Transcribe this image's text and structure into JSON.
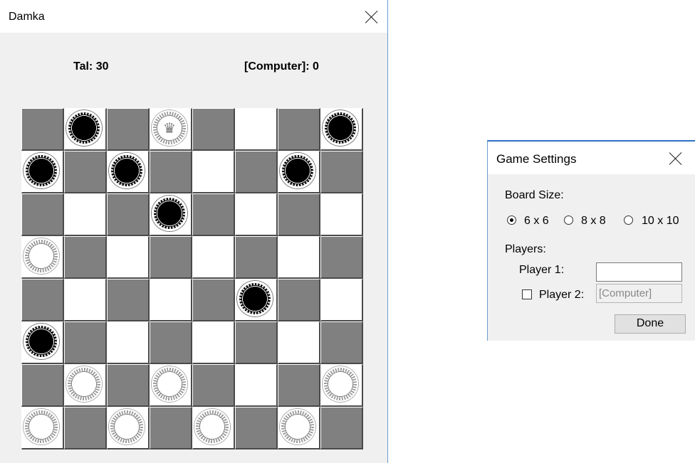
{
  "damka": {
    "title": "Damka",
    "score_player1": "Tal: 30",
    "score_player2": "[Computer]: 0",
    "board": [
      [
        "",
        "B",
        "",
        "WK",
        "",
        "",
        "",
        "B"
      ],
      [
        "B",
        "",
        "B",
        "",
        "",
        "",
        "B",
        ""
      ],
      [
        "",
        "",
        "",
        "B",
        "",
        "",
        "",
        ""
      ],
      [
        "W",
        "",
        "",
        "",
        "",
        "",
        "",
        ""
      ],
      [
        "",
        "",
        "",
        "",
        "",
        "B",
        "",
        ""
      ],
      [
        "B",
        "",
        "",
        "",
        "",
        "",
        "",
        ""
      ],
      [
        "",
        "W",
        "",
        "W",
        "",
        "",
        "",
        "W"
      ],
      [
        "W",
        "",
        "W",
        "",
        "W",
        "",
        "W",
        ""
      ]
    ],
    "cell_colors": [
      "DLDLDLDL",
      "LDLDLDLD",
      "DLDLDLDL",
      "LDLDLDLD",
      "DLDLDLDL",
      "LDLDLDLD",
      "DLDLDLDL",
      "LDLDLDLD"
    ],
    "colors": {
      "dark_square": "#808080",
      "light_square": "#ffffff"
    },
    "king_icon": "♛"
  },
  "settings": {
    "title": "Game Settings",
    "board_size_label": "Board Size:",
    "size_options": [
      {
        "label": "6 x 6",
        "selected": true
      },
      {
        "label": "8 x 8",
        "selected": false
      },
      {
        "label": "10 x 10",
        "selected": false
      }
    ],
    "players_label": "Players:",
    "player1_label": "Player 1:",
    "player1_value": "",
    "player2_label": "Player 2:",
    "player2_checked": false,
    "player2_value": "[Computer]",
    "done_label": "Done"
  }
}
